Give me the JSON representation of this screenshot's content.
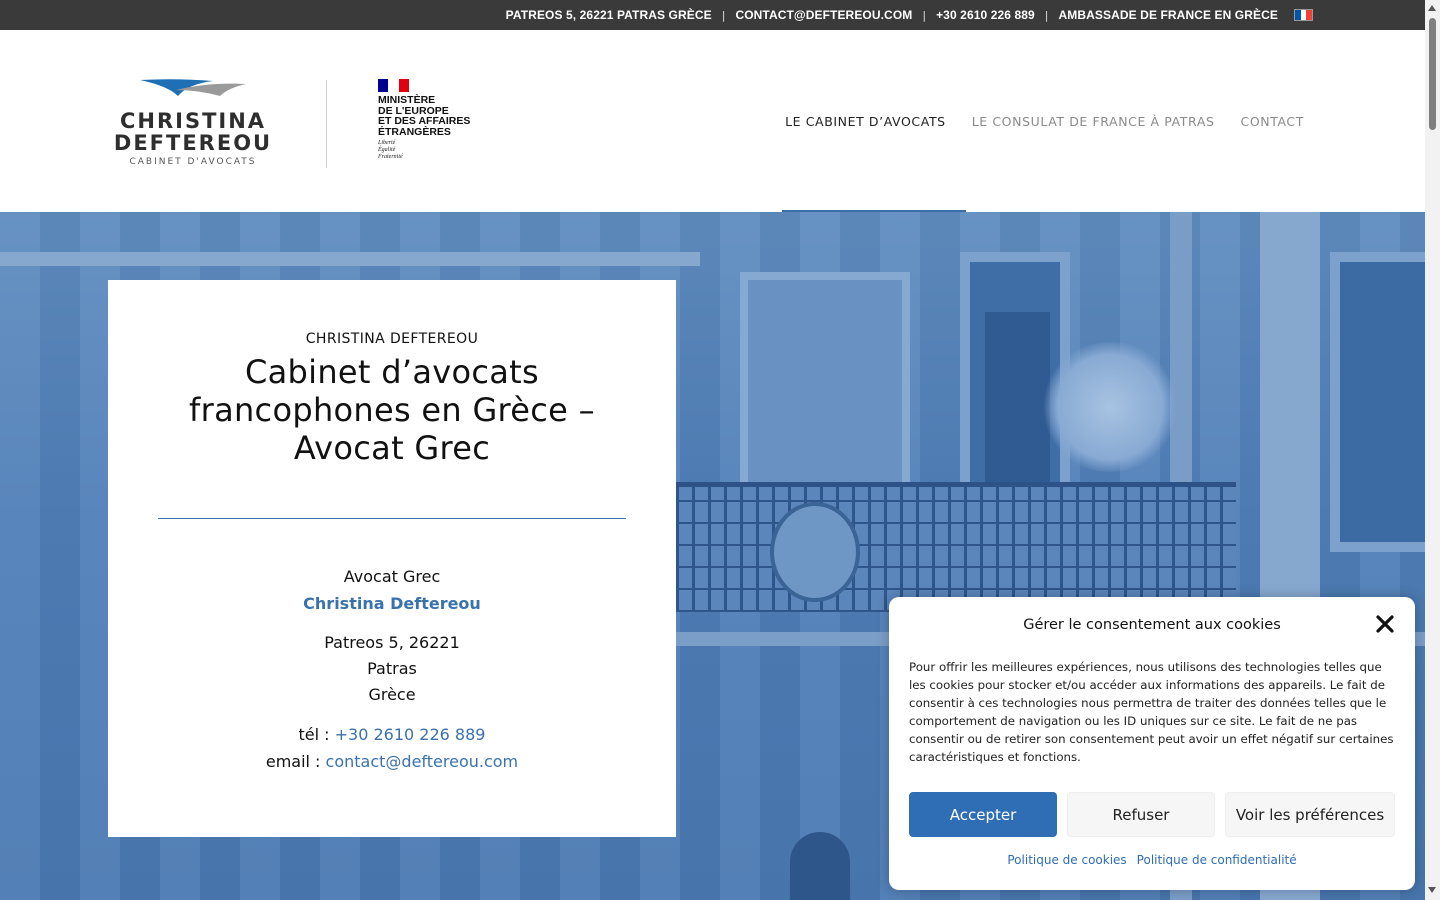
{
  "topbar": {
    "address": "PATREOS 5, 26221 PATRAS GRÈCE",
    "email": "CONTACT@DEFTEREOU.COM",
    "phone": "+30 2610 226 889",
    "embassy": "AMBASSADE DE FRANCE EN GRÈCE",
    "language_flag": "french-flag-icon"
  },
  "logo": {
    "name_line1": "CHRISTINA",
    "name_line2": "DEFTEREOU",
    "subtitle": "CABINET D'AVOCATS"
  },
  "ministere": {
    "line1": "MINISTÈRE",
    "line2": "DE L'EUROPE",
    "line3": "ET DES AFFAIRES",
    "line4": "ÉTRANGÈRES",
    "motto1": "Liberté",
    "motto2": "Égalité",
    "motto3": "Fraternité"
  },
  "nav": {
    "items": [
      {
        "label": "LE CABINET D’AVOCATS",
        "active": true
      },
      {
        "label": "LE CONSULAT DE FRANCE À PATRAS",
        "active": false
      },
      {
        "label": "CONTACT",
        "active": false
      }
    ]
  },
  "card": {
    "kicker": "CHRISTINA DEFTEREOU",
    "title": "Cabinet d’avocats francophones en Grèce – Avocat Grec",
    "role": "Avocat Grec",
    "name": "Christina Deftereou",
    "address_line1": "Patreos 5, 26221",
    "address_line2": "Patras",
    "address_line3": "Grèce",
    "tel_label": "tél : ",
    "tel_value": "+30 2610 226 889",
    "email_label": "email : ",
    "email_value": "contact@deftereou.com"
  },
  "cookie": {
    "title": "Gérer le consentement aux cookies",
    "text": "Pour offrir les meilleures expériences, nous utilisons des technologies telles que les cookies pour stocker et/ou accéder aux informations des appareils. Le fait de consentir à ces technologies nous permettra de traiter des données telles que le comportement de navigation ou les ID uniques sur ce site. Le fait de ne pas consentir ou de retirer son consentement peut avoir un effet négatif sur certaines caractéristiques et fonctions.",
    "accept": "Accepter",
    "refuse": "Refuser",
    "preferences": "Voir les préférences",
    "cookie_policy": "Politique de cookies",
    "privacy_policy": "Politique de confidentialité"
  },
  "colors": {
    "accent": "#3a72ad",
    "topbar": "#3a3a3a",
    "accept_button": "#2f6db5",
    "hero_tint": "#4f7fb8"
  }
}
